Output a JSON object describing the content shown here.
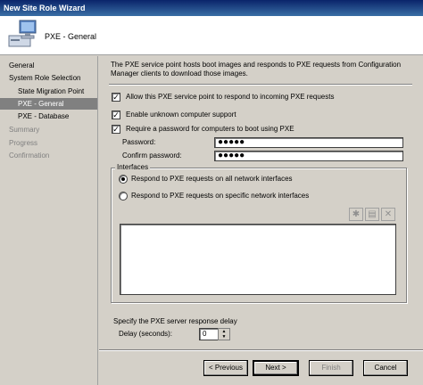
{
  "window": {
    "title": "New Site Role Wizard"
  },
  "header": {
    "page_title": "PXE - General"
  },
  "sidebar": {
    "items": [
      {
        "label": "General",
        "state": "normal"
      },
      {
        "label": "System Role Selection",
        "state": "normal"
      },
      {
        "label": "State Migration Point",
        "state": "sub"
      },
      {
        "label": "PXE - General",
        "state": "active"
      },
      {
        "label": "PXE - Database",
        "state": "sub"
      },
      {
        "label": "Summary",
        "state": "disabled"
      },
      {
        "label": "Progress",
        "state": "disabled"
      },
      {
        "label": "Confirmation",
        "state": "disabled"
      }
    ]
  },
  "main": {
    "description": "The PXE service point hosts boot images and responds to PXE requests from Configuration Manager clients to download those images.",
    "allow_pxe": {
      "label": "Allow this PXE service point to respond to incoming PXE requests",
      "checked": true
    },
    "unknown_support": {
      "label": "Enable unknown computer support",
      "checked": true
    },
    "require_password": {
      "label": "Require a password for computers to boot using PXE",
      "checked": true
    },
    "password": {
      "label": "Password:",
      "value": "●●●●●"
    },
    "confirm_password": {
      "label": "Confirm password:",
      "value": "●●●●●"
    },
    "interfaces": {
      "legend": "Interfaces",
      "all": {
        "label": "Respond to PXE requests on all network interfaces",
        "selected": true
      },
      "specific": {
        "label": "Respond to PXE requests on specific network interfaces",
        "selected": false
      }
    },
    "delay": {
      "prompt": "Specify the PXE server response delay",
      "label": "Delay (seconds):",
      "value": "0"
    }
  },
  "footer": {
    "previous": "< Previous",
    "next": "Next >",
    "finish": "Finish",
    "cancel": "Cancel"
  }
}
